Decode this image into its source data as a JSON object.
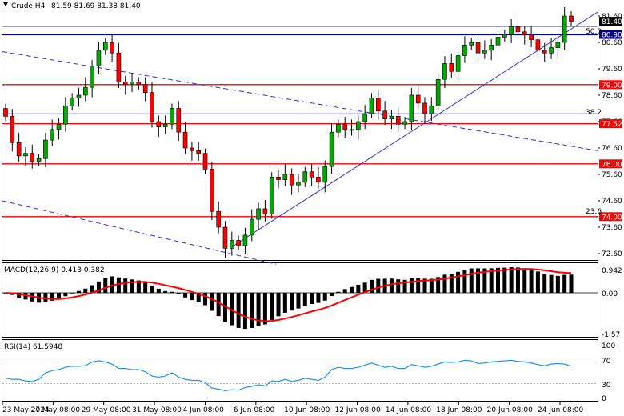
{
  "header": {
    "menu_icon": "triangle-down-icon",
    "symbol_label": "Crude,H4",
    "ohlc_text": "81.59 81.69 81.38 81.40"
  },
  "price_axis": {
    "ticks": [
      "81.60",
      "80.60",
      "79.60",
      "78.60",
      "77.60",
      "76.60",
      "75.60",
      "74.60",
      "73.60",
      "72.60"
    ],
    "current_price": "81.40",
    "badges": [
      {
        "label": "80.90",
        "value": 80.9
      },
      {
        "label": "79.00",
        "value": 79.0
      },
      {
        "label": "77.52",
        "value": 77.52
      },
      {
        "label": "76.00",
        "value": 76.0
      },
      {
        "label": "74.00",
        "value": 74.0
      }
    ]
  },
  "fib_labels": [
    {
      "label": "50.0",
      "value": 81.2
    },
    {
      "label": "38.2",
      "value": 77.9
    },
    {
      "label": "23.6",
      "value": 74.1
    }
  ],
  "levels": {
    "support_resistance": [
      79.0,
      77.52,
      76.0,
      74.0
    ],
    "key_level": 80.9,
    "fib_lines": [
      81.2,
      77.9,
      74.1
    ]
  },
  "macd": {
    "label": "MACD(12,26,9) 0.413 0.382",
    "ticks": [
      "0.942",
      "0.00",
      "-1.57"
    ],
    "hist_color": "#000000",
    "signal_color": "#ff0000"
  },
  "rsi": {
    "label": "RSI(14) 61.5948",
    "ticks": [
      "100",
      "70",
      "30",
      "0"
    ],
    "line_color": "#1e90ff"
  },
  "time_axis": {
    "labels": [
      "23 May 2024",
      "27 May 08:00",
      "29 May 08:00",
      "31 May 08:00",
      "4 Jun 08:00",
      "6 Jun 08:00",
      "10 Jun 08:00",
      "12 Jun 08:00",
      "14 Jun 08:00",
      "18 Jun 08:00",
      "20 Jun 08:00",
      "24 Jun 08:00"
    ]
  },
  "colors": {
    "bull": "#00aa00",
    "bear": "#ff0000",
    "level_line": "#ff0000",
    "key_line": "#00008b",
    "trend_line": "#3333cc",
    "badge_bg": "#ff0000",
    "badge_key_bg": "#00008b",
    "price_badge_bg": "#000000"
  },
  "chart_data": {
    "type": "candlestick",
    "symbol": "Crude",
    "timeframe": "H4",
    "ylim": [
      72.2,
      81.9
    ],
    "close": [
      77.8,
      76.8,
      76.3,
      76.4,
      76.1,
      76.2,
      76.9,
      77.3,
      77.5,
      78.2,
      78.5,
      78.6,
      78.9,
      79.7,
      80.3,
      80.6,
      80.2,
      79.1,
      79.0,
      79.1,
      79.0,
      78.7,
      77.6,
      77.4,
      77.5,
      78.1,
      77.2,
      76.6,
      76.5,
      76.4,
      75.8,
      74.2,
      73.6,
      72.8,
      73.1,
      72.9,
      73.3,
      73.9,
      74.3,
      74.1,
      75.5,
      75.4,
      75.6,
      75.2,
      75.3,
      75.7,
      75.5,
      75.3,
      75.9,
      77.2,
      77.5,
      77.3,
      77.3,
      77.6,
      77.9,
      78.5,
      78.0,
      77.7,
      77.8,
      77.5,
      77.6,
      78.6,
      78.3,
      77.9,
      78.2,
      79.2,
      79.8,
      79.5,
      80.1,
      80.5,
      80.6,
      80.2,
      80.3,
      80.5,
      80.8,
      80.9,
      81.2,
      81.0,
      80.9,
      80.7,
      80.3,
      80.2,
      80.4,
      80.6,
      81.6,
      81.4
    ],
    "rsi_values": [
      40,
      38,
      38,
      35,
      34,
      38,
      50,
      54,
      56,
      60,
      62,
      62,
      63,
      70,
      72,
      70,
      66,
      58,
      58,
      56,
      56,
      52,
      44,
      42,
      44,
      50,
      42,
      38,
      36,
      36,
      32,
      22,
      20,
      17,
      19,
      18,
      23,
      25,
      28,
      26,
      35,
      34,
      38,
      34,
      36,
      40,
      38,
      36,
      42,
      56,
      60,
      58,
      58,
      60,
      64,
      68,
      64,
      60,
      62,
      58,
      58,
      65,
      63,
      60,
      62,
      66,
      70,
      69,
      70,
      73,
      72,
      67,
      68,
      70,
      71,
      72,
      73,
      71,
      70,
      68,
      65,
      63,
      66,
      67,
      66,
      62
    ]
  }
}
